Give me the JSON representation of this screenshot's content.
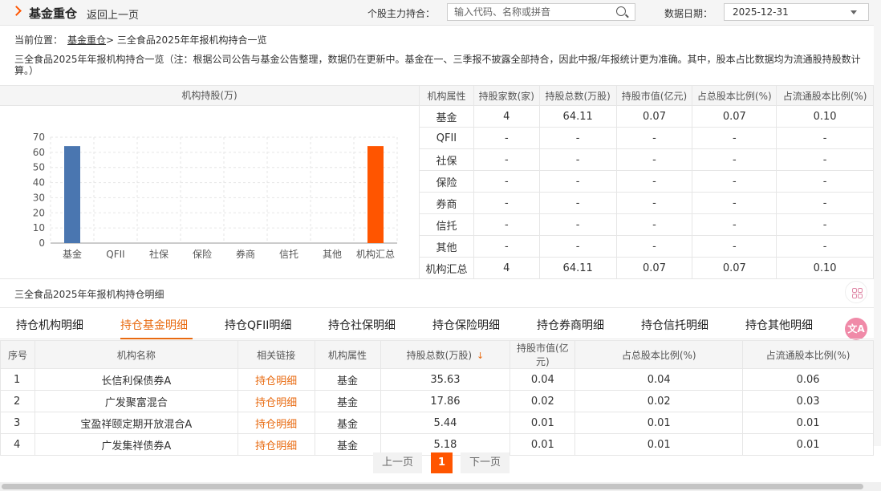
{
  "header": {
    "title": "基金重仓",
    "back_label": "返回上一页",
    "stock_search_label": "个股主力持合：",
    "search_placeholder": "输入代码、名称或拼音",
    "date_label": "数据日期：",
    "date_value": "2025-12-31"
  },
  "breadcrumb": {
    "prefix": "当前位置：",
    "link": "基金重仓",
    "separator": ">",
    "current": "三全食品2025年年报机构持合一览"
  },
  "note": "三全食品2025年年报机构持合一览（注：根据公司公告与基金公告整理，数据仍在更新中。基金在一、三季报不披露全部持合，因此中报/年报统计更为准确。其中，股本占比数据均为流通股持股数计算。）",
  "chart_data": {
    "type": "bar",
    "title": "机构持股(万)",
    "categories": [
      "基金",
      "QFII",
      "社保",
      "保险",
      "券商",
      "信托",
      "其他",
      "机构汇总"
    ],
    "values": [
      64.11,
      0,
      0,
      0,
      0,
      0,
      0,
      64.11
    ],
    "colors": [
      "#4a76b0",
      "#4a76b0",
      "#4a76b0",
      "#4a76b0",
      "#4a76b0",
      "#4a76b0",
      "#4a76b0",
      "#ff5500"
    ],
    "ylim": [
      0,
      70
    ],
    "yticks": [
      0,
      10,
      20,
      30,
      40,
      50,
      60,
      70
    ],
    "grid": true,
    "xlabel": "",
    "ylabel": ""
  },
  "stats_table": {
    "headers": [
      "机构属性",
      "持股家数(家)",
      "持股总数(万股)",
      "持股市值(亿元)",
      "占总股本比例(%)",
      "占流通股本比例(%)"
    ],
    "rows": [
      [
        "基金",
        "4",
        "64.11",
        "0.07",
        "0.07",
        "0.10"
      ],
      [
        "QFII",
        "-",
        "-",
        "-",
        "-",
        "-"
      ],
      [
        "社保",
        "-",
        "-",
        "-",
        "-",
        "-"
      ],
      [
        "保险",
        "-",
        "-",
        "-",
        "-",
        "-"
      ],
      [
        "券商",
        "-",
        "-",
        "-",
        "-",
        "-"
      ],
      [
        "信托",
        "-",
        "-",
        "-",
        "-",
        "-"
      ],
      [
        "其他",
        "-",
        "-",
        "-",
        "-",
        "-"
      ],
      [
        "机构汇总",
        "4",
        "64.11",
        "0.07",
        "0.07",
        "0.10"
      ]
    ]
  },
  "detail_title": "三全食品2025年年报机构持仓明细",
  "tabs": [
    {
      "label": "持仓机构明细",
      "active": false
    },
    {
      "label": "持仓基金明细",
      "active": true
    },
    {
      "label": "持仓QFII明细",
      "active": false
    },
    {
      "label": "持仓社保明细",
      "active": false
    },
    {
      "label": "持仓保险明细",
      "active": false
    },
    {
      "label": "持仓券商明细",
      "active": false
    },
    {
      "label": "持仓信托明细",
      "active": false
    },
    {
      "label": "持仓其他明细",
      "active": false
    }
  ],
  "detail_table": {
    "headers": [
      "序号",
      "机构名称",
      "相关链接",
      "机构属性",
      "持股总数(万股)",
      "持股市值(亿元)",
      "占总股本比例(%)",
      "占流通股本比例(%)"
    ],
    "sort_icon": "sort-desc-arrow",
    "rows": [
      [
        "1",
        "长信利保债券A",
        "持仓明细",
        "基金",
        "35.63",
        "0.04",
        "0.04",
        "0.06"
      ],
      [
        "2",
        "广发聚富混合",
        "持仓明细",
        "基金",
        "17.86",
        "0.02",
        "0.02",
        "0.03"
      ],
      [
        "3",
        "宝盈祥颐定期开放混合A",
        "持仓明细",
        "基金",
        "5.44",
        "0.01",
        "0.01",
        "0.01"
      ],
      [
        "4",
        "广发集祥债券A",
        "持仓明细",
        "基金",
        "5.18",
        "0.01",
        "0.01",
        "0.01"
      ]
    ]
  },
  "pagination": {
    "prev_label": "上一页",
    "current_page": "1",
    "next_label": "下一页"
  },
  "side_icons": [
    "grid-app-icon",
    "translate-icon"
  ],
  "side_translate_glyph": "文A",
  "colors": {
    "accent": "#e86a10",
    "brand_orange": "#ff5500",
    "bar_blue": "#4a76b0"
  }
}
